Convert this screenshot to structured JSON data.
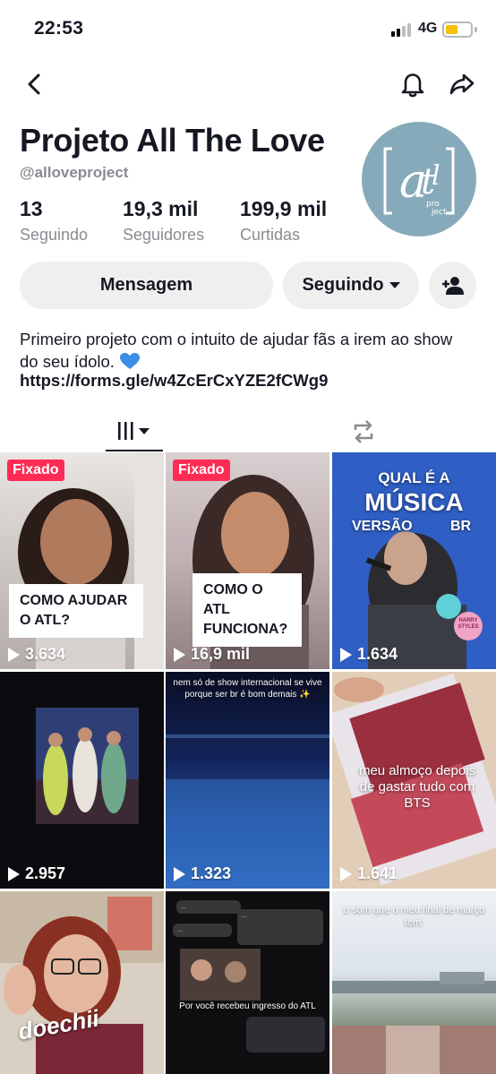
{
  "status_bar": {
    "time": "22:53",
    "network": "4G"
  },
  "profile": {
    "name": "Projeto All The Love",
    "handle": "@alloveproject",
    "avatar_text": "atl project",
    "stats": [
      {
        "value": "13",
        "label": "Seguindo"
      },
      {
        "value": "19,3 mil",
        "label": "Seguidores"
      },
      {
        "value": "199,9 mil",
        "label": "Curtidas"
      }
    ],
    "buttons": {
      "message": "Mensagem",
      "following": "Seguindo"
    },
    "bio": "Primeiro projeto com o intuito de ajudar fãs a irem ao show do seu ídolo.",
    "link": "https://forms.gle/w4ZcErCxYZE2fCWg9"
  },
  "videos": [
    {
      "views": "3.634",
      "pinned_label": "Fixado",
      "caption": "COMO AJUDAR O ATL?"
    },
    {
      "views": "16,9 mil",
      "pinned_label": "Fixado",
      "caption": "COMO O ATL FUNCIONA?"
    },
    {
      "views": "1.634",
      "headline": "QUAL É A",
      "headline2": "MÚSICA",
      "sub": "VERSÃO",
      "sub2": "BR",
      "badge": "HARRY STYLES"
    },
    {
      "views": "2.957"
    },
    {
      "views": "1.323",
      "overlay": "nem só de show internacional se vive porque ser br é bom demais ✨"
    },
    {
      "views": "1.641",
      "overlay": "meu almoço depois de gastar tudo com BTS"
    },
    {
      "views": "",
      "overlay": "doechii"
    },
    {
      "views": "",
      "overlay": "Por você recebeu ingresso do ATL"
    },
    {
      "views": "",
      "overlay": "o som que o meu final de março tem:"
    }
  ],
  "colors": {
    "accent": "#fe2c55",
    "heart": "#3a8ee6",
    "avatar_bg": "#86aab9"
  },
  "icons": [
    "back-icon",
    "bell-icon",
    "share-icon",
    "add-friend-icon",
    "grid-icon",
    "repost-icon",
    "play-icon",
    "tiktok-icon"
  ]
}
